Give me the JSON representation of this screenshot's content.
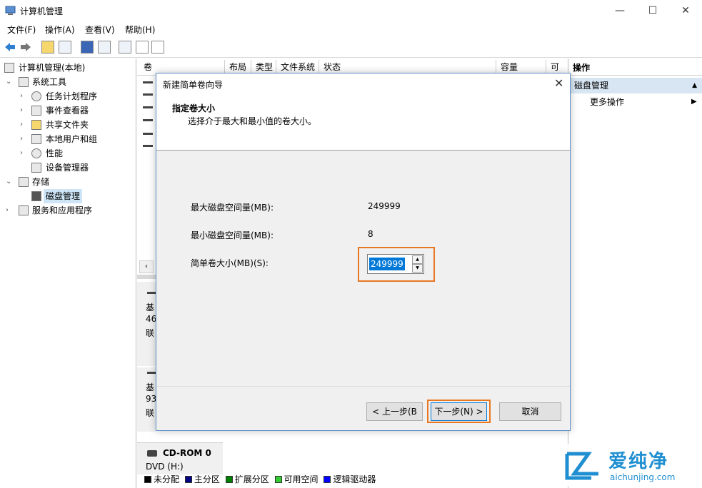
{
  "window": {
    "title": "计算机管理",
    "controls": {
      "minimize": "—",
      "maximize": "☐",
      "close": "✕"
    }
  },
  "menu": [
    "文件(F)",
    "操作(A)",
    "查看(V)",
    "帮助(H)"
  ],
  "tree": [
    {
      "label": "计算机管理(本地)",
      "icon": "computer-management-icon"
    },
    {
      "label": "系统工具",
      "icon": "tools-icon"
    },
    {
      "label": "任务计划程序",
      "icon": "clock-icon"
    },
    {
      "label": "事件查看器",
      "icon": "event-viewer-icon"
    },
    {
      "label": "共享文件夹",
      "icon": "shared-folder-icon"
    },
    {
      "label": "本地用户和组",
      "icon": "users-icon"
    },
    {
      "label": "性能",
      "icon": "performance-icon"
    },
    {
      "label": "设备管理器",
      "icon": "device-manager-icon"
    },
    {
      "label": "存储",
      "icon": "storage-icon"
    },
    {
      "label": "磁盘管理",
      "icon": "disk-icon"
    },
    {
      "label": "服务和应用程序",
      "icon": "services-icon"
    }
  ],
  "columns": [
    "卷",
    "布局",
    "类型",
    "文件系统",
    "状态",
    "容量",
    "可"
  ],
  "disks": {
    "disk0": [
      "基",
      "46",
      "联"
    ],
    "disk1": [
      "基",
      "93",
      "联"
    ],
    "cdrom": {
      "name": "CD-ROM 0",
      "drive": "DVD (H:)"
    }
  },
  "legend": [
    {
      "label": "未分配",
      "color": "#000000"
    },
    {
      "label": "主分区",
      "color": "#000080"
    },
    {
      "label": "扩展分区",
      "color": "#008000"
    },
    {
      "label": "可用空间",
      "color": "#33cc33"
    },
    {
      "label": "逻辑驱动器",
      "color": "#0000ff"
    }
  ],
  "actions": {
    "header": "操作",
    "section": "磁盘管理",
    "more": "更多操作"
  },
  "dialog": {
    "title": "新建简单卷向导",
    "heading": "指定卷大小",
    "subheading": "选择介于最大和最小值的卷大小。",
    "max_label": "最大磁盘空间量(MB):",
    "max_value": "249999",
    "min_label": "最小磁盘空间量(MB):",
    "min_value": "8",
    "size_label": "简单卷大小(MB)(S):",
    "size_value": "249999",
    "back": "< 上一步(B",
    "next": "下一步(N) >",
    "cancel": "取消"
  },
  "watermark": {
    "brand": "爱纯净",
    "url": "aichunjing.com"
  },
  "colors": {
    "accent": "#0078d7",
    "highlight": "#e87722"
  }
}
